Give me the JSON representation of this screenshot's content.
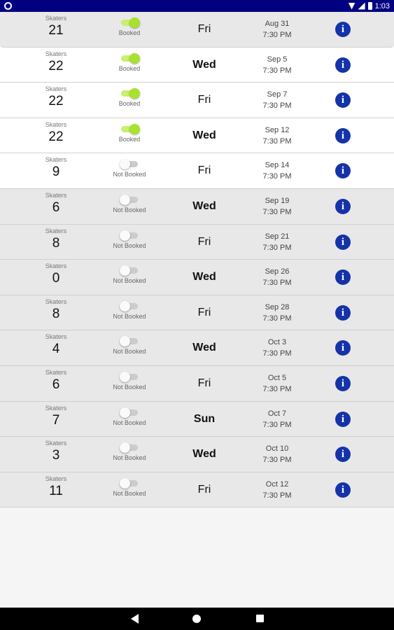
{
  "status_bar": {
    "time": "1:03"
  },
  "sessions": [
    {
      "skaters_label": "Skaters",
      "skaters": "21",
      "booked": true,
      "booking_label": "Booked",
      "day": "Fri",
      "date": "Aug 31",
      "time": "7:30 PM"
    },
    {
      "skaters_label": "Skaters",
      "skaters": "22",
      "booked": true,
      "booking_label": "Booked",
      "day": "Wed",
      "date": "Sep 5",
      "time": "7:30 PM"
    },
    {
      "skaters_label": "Skaters",
      "skaters": "22",
      "booked": true,
      "booking_label": "Booked",
      "day": "Fri",
      "date": "Sep 7",
      "time": "7:30 PM"
    },
    {
      "skaters_label": "Skaters",
      "skaters": "22",
      "booked": true,
      "booking_label": "Booked",
      "day": "Wed",
      "date": "Sep 12",
      "time": "7:30 PM"
    },
    {
      "skaters_label": "Skaters",
      "skaters": "9",
      "booked": false,
      "booking_label": "Not Booked",
      "day": "Fri",
      "date": "Sep 14",
      "time": "7:30 PM"
    },
    {
      "skaters_label": "Skaters",
      "skaters": "6",
      "booked": false,
      "booking_label": "Not Booked",
      "day": "Wed",
      "date": "Sep 19",
      "time": "7:30 PM"
    },
    {
      "skaters_label": "Skaters",
      "skaters": "8",
      "booked": false,
      "booking_label": "Not Booked",
      "day": "Fri",
      "date": "Sep 21",
      "time": "7:30 PM"
    },
    {
      "skaters_label": "Skaters",
      "skaters": "0",
      "booked": false,
      "booking_label": "Not Booked",
      "day": "Wed",
      "date": "Sep 26",
      "time": "7:30 PM"
    },
    {
      "skaters_label": "Skaters",
      "skaters": "8",
      "booked": false,
      "booking_label": "Not Booked",
      "day": "Fri",
      "date": "Sep 28",
      "time": "7:30 PM"
    },
    {
      "skaters_label": "Skaters",
      "skaters": "4",
      "booked": false,
      "booking_label": "Not Booked",
      "day": "Wed",
      "date": "Oct 3",
      "time": "7:30 PM"
    },
    {
      "skaters_label": "Skaters",
      "skaters": "6",
      "booked": false,
      "booking_label": "Not Booked",
      "day": "Fri",
      "date": "Oct 5",
      "time": "7:30 PM"
    },
    {
      "skaters_label": "Skaters",
      "skaters": "7",
      "booked": false,
      "booking_label": "Not Booked",
      "day": "Sun",
      "date": "Oct 7",
      "time": "7:30 PM"
    },
    {
      "skaters_label": "Skaters",
      "skaters": "3",
      "booked": false,
      "booking_label": "Not Booked",
      "day": "Wed",
      "date": "Oct 10",
      "time": "7:30 PM"
    },
    {
      "skaters_label": "Skaters",
      "skaters": "11",
      "booked": false,
      "booking_label": "Not Booked",
      "day": "Fri",
      "date": "Oct 12",
      "time": "7:30 PM"
    }
  ],
  "info_button": {
    "glyph": "i"
  },
  "colors": {
    "status_bar": "#000080",
    "toggle_on": "#a6e22e",
    "info_button": "#1533a8"
  }
}
